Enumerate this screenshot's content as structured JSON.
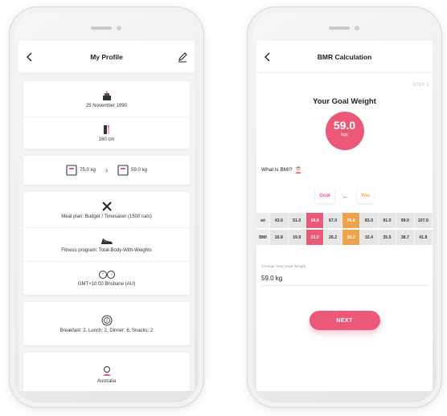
{
  "profile": {
    "title": "My Profile",
    "birthday": "25 November 1990",
    "height": "160 cm",
    "current_weight": "75.0 kg",
    "goal_weight": "59.0 kg",
    "weight_arrow": "›",
    "meal_plan": "Meal plan: Budget / Timesaver (1500 cals)",
    "fitness_program": "Fitness program: Total-Body-With-Weights",
    "timezone": "GMT+10:00 Brisbane (AU)",
    "meals": "Breakfast: 2, Lunch: 2, Dinner: 6, Snacks: 2",
    "country": "Australia"
  },
  "bmr": {
    "title": "BMR Calculation",
    "step": "STEP 2",
    "heading": "Your Goal Weight",
    "goal_value": "59.0",
    "goal_unit": "kgs",
    "bmi_question": "What is BMI?",
    "legend": {
      "goal": "Goal",
      "arrow": "←",
      "you": "You"
    },
    "table": {
      "wt_label": "wt",
      "bmi_label": "BMI",
      "wt": [
        "43.0",
        "51.0",
        "59.0",
        "67.0",
        "75.0",
        "83.0",
        "91.0",
        "99.0",
        "107.0"
      ],
      "bmi": [
        "16.8",
        "19.9",
        "23.0",
        "26.2",
        "29.3",
        "32.4",
        "35.5",
        "38.7",
        "41.8"
      ],
      "goal_index": 2,
      "you_index": 4
    },
    "change_label": "Change Your Goal Weight",
    "change_value": "59.0 kg",
    "next": "NEXT"
  },
  "colors": {
    "accent_pink": "#ec5878",
    "accent_orange": "#f0a24a",
    "background": "#f3f3f3"
  },
  "icons": [
    "chevron-left-icon",
    "pencil-icon",
    "cake-icon",
    "height-icon",
    "scale-icon",
    "cutlery-icon",
    "shoe-icon",
    "clock-icon",
    "plate-icon",
    "globe-person-icon",
    "person-icon"
  ]
}
